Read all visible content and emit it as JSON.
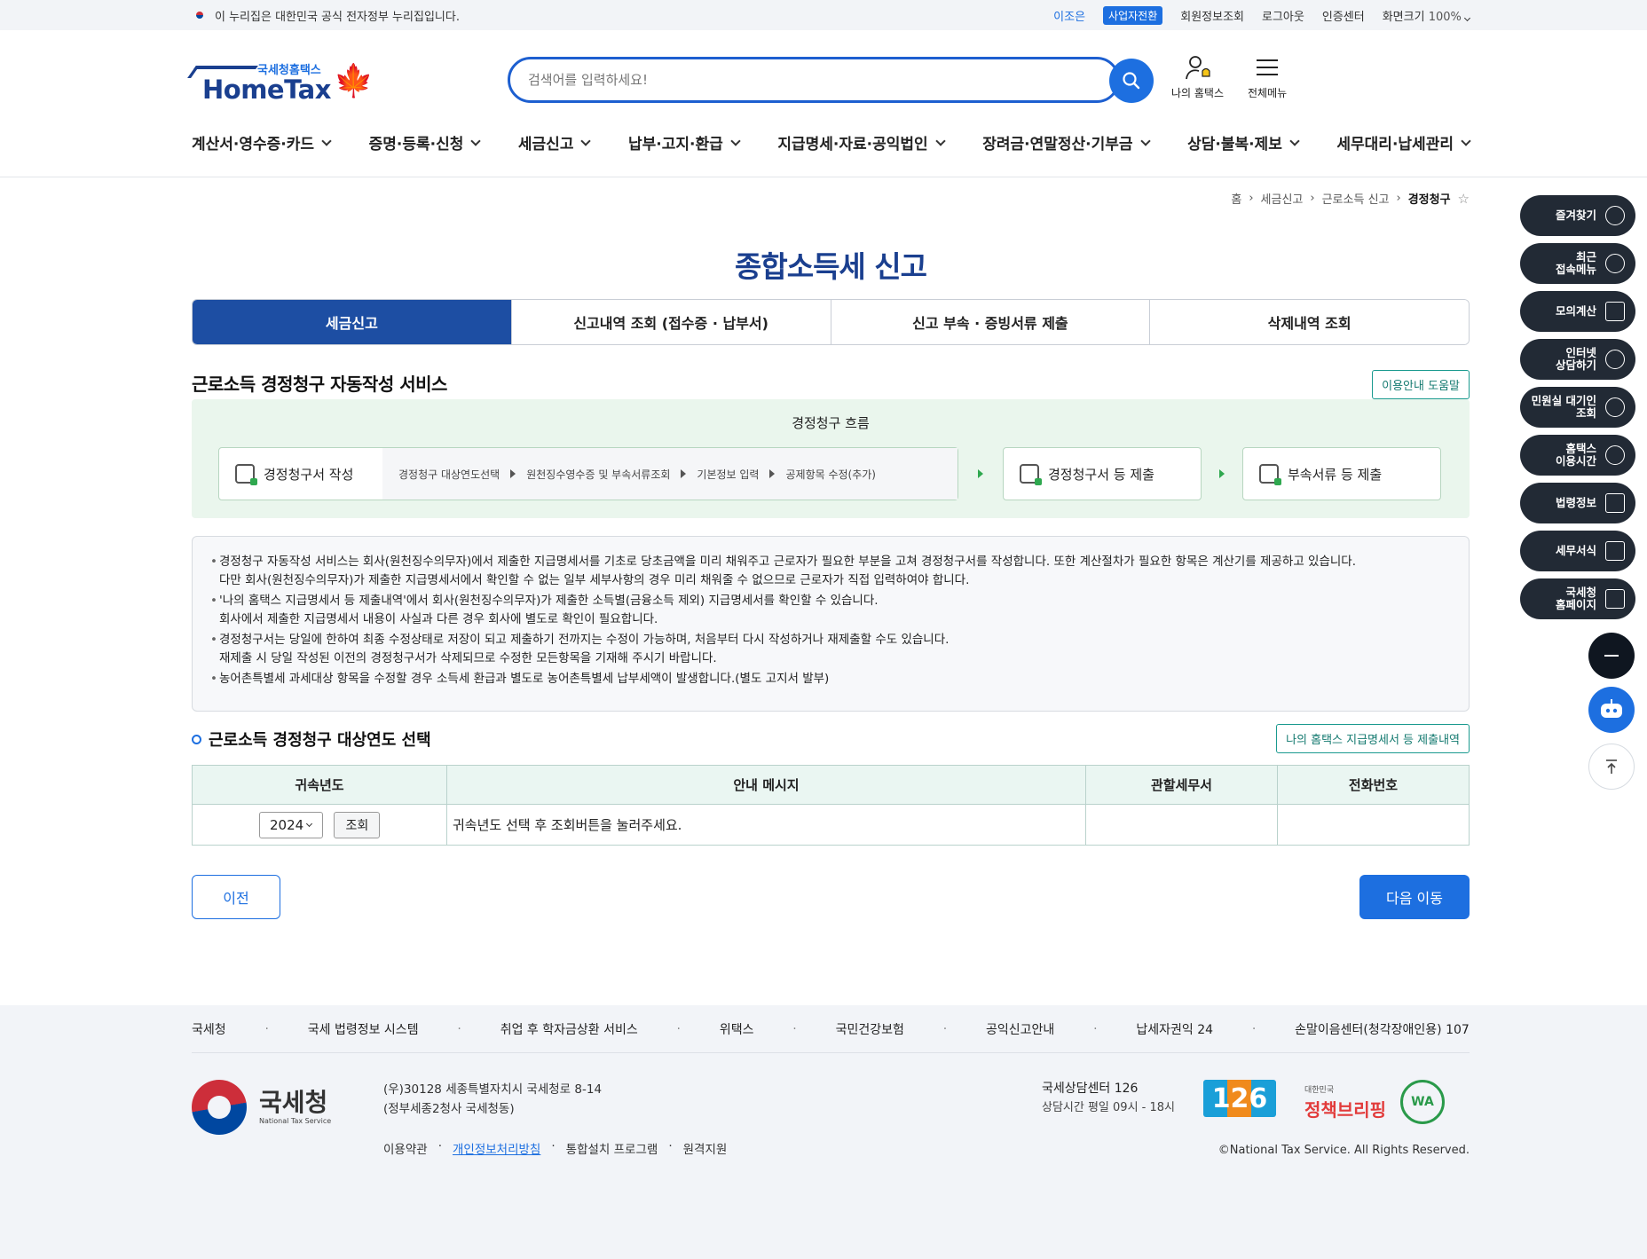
{
  "govbar": {
    "notice": "이 누리집은 대한민국 공식 전자정부 누리집입니다.",
    "links": [
      "이조은",
      "사업자전환",
      "회원정보조회",
      "로그아웃",
      "인증센터"
    ],
    "zoom_label": "화면크기",
    "zoom_value": "100%"
  },
  "header": {
    "logo_sub": "국세청홈택스",
    "logo_main": "HomeTax",
    "search_placeholder": "검색어를 입력하세요!",
    "my_hometax": "나의 홈택스",
    "all_menu": "전체메뉴",
    "gnb": [
      "계산서·영수증·카드",
      "증명·등록·신청",
      "세금신고",
      "납부·고지·환급",
      "지급명세·자료·공익법인",
      "장려금·연말정산·기부금",
      "상담·불복·제보",
      "세무대리·납세관리"
    ]
  },
  "breadcrumb": [
    "홈",
    "세금신고",
    "근로소득 신고",
    "경정청구"
  ],
  "page_title": "종합소득세 신고",
  "tabs": [
    "세금신고",
    "신고내역 조회 (접수증 · 납부서)",
    "신고 부속 · 증빙서류 제출",
    "삭제내역 조회"
  ],
  "section": {
    "title": "근로소득 경정청구 자동작성 서비스",
    "help_button": "이용안내 도움말"
  },
  "flow": {
    "title": "경정청구 흐름",
    "step1": "경정청구서 작성",
    "substeps": [
      "경정청구 대상연도선택",
      "원천징수영수증 및 부속서류조회",
      "기본정보 입력",
      "공제항목 수정(추가)"
    ],
    "step2": "경정청구서 등 제출",
    "step3": "부속서류 등 제출"
  },
  "notices": [
    "경정청구 자동작성 서비스는 회사(원천징수의무자)에서 제출한 지급명세서를 기초로 당초금액을 미리 채워주고 근로자가 필요한 부분을 고쳐 경정청구서를 작성합니다. 또한 계산절차가 필요한 항목은 계산기를 제공하고 있습니다.",
    "다만 회사(원천징수의무자)가 제출한 지급명세서에서 확인할 수 없는 일부 세부사항의 경우 미리 채워줄 수 없으므로 근로자가 직접 입력하여야 합니다.",
    "'나의 홈택스 지급명세서 등 제출내역'에서 회사(원천징수의무자)가 제출한 소득별(금융소득 제외) 지급명세서를 확인할 수 있습니다.",
    "회사에서 제출한 지급명세서 내용이 사실과 다른 경우 회사에 별도로 확인이 필요합니다.",
    "경정청구서는 당일에 한하여 최종 수정상태로 저장이 되고 제출하기 전까지는 수정이 가능하며, 처음부터 다시 작성하거나 재제출할 수도 있습니다.",
    "재제출 시 당일 작성된 이전의 경정청구서가 삭제되므로 수정한 모든항목을 기재해 주시기 바랍니다.",
    "농어촌특별세 과세대상 항목을 수정할 경우 소득세 환급과 별도로 농어촌특별세 납부세액이 발생합니다.(별도 고지서 발부)"
  ],
  "year_section": {
    "title": "근로소득 경정청구 대상연도 선택",
    "link_button": "나의 홈택스 지급명세서 등 제출내역",
    "columns": [
      "귀속년도",
      "안내 메시지",
      "관할세무서",
      "전화번호"
    ],
    "selected_year": "2024",
    "query_button": "조회",
    "message": "귀속년도 선택 후 조회버튼을 눌러주세요."
  },
  "buttons": {
    "prev": "이전",
    "next": "다음 이동"
  },
  "quick_menu": [
    "즐겨찾기",
    "최근\n접속메뉴",
    "모의계산",
    "인터넷\n상담하기",
    "민원실 대기인\n조회",
    "홈택스\n이용시간",
    "법령정보",
    "세무서식",
    "국세청\n홈페이지"
  ],
  "footer": {
    "links": [
      "국세청",
      "국세 법령정보 시스템",
      "취업 후 학자금상환 서비스",
      "위택스",
      "국민건강보험",
      "공익신고안내",
      "납세자권익 24",
      "손말이음센터(청각장애인용) 107"
    ],
    "org_name": "국세청",
    "org_eng": "National Tax Service",
    "address1": "(우)30128 세종특별자치시 국세청로 8-14",
    "address2": "(정부세종2청사 국세청동)",
    "bottom_links": [
      "이용약관",
      "개인정보처리방침",
      "통합설치 프로그램",
      "원격지원"
    ],
    "center_name": "국세상담센터 126",
    "center_hours": "상담시간 평일 09시 - 18시",
    "badge_126": "126",
    "briefing_sub": "대한민국",
    "briefing_title": "정책브리핑",
    "wa_mark": "WA",
    "copyright": "©National Tax Service. All Rights Reserved."
  }
}
